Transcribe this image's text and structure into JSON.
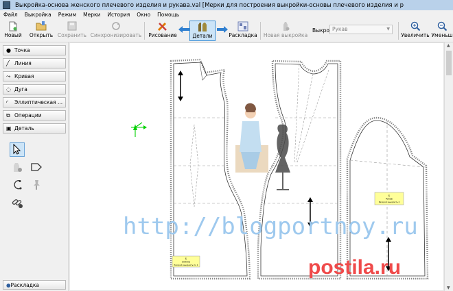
{
  "window": {
    "title": "Выкройка-основа женского плечевого изделия и рукава.val [Мерки для построения выкройки-основы плечевого изделия и р"
  },
  "menu": [
    "Файл",
    "Выкройка",
    "Режим",
    "Мерки",
    "История",
    "Окно",
    "Помощь"
  ],
  "toolbar": {
    "new": "Новый",
    "open": "Открыть",
    "save": "Сохранить",
    "sync": "Синхронизировать",
    "draw": "Рисование",
    "details": "Детали",
    "layout": "Раскладка",
    "new_pattern": "Новая выкройка",
    "pattern_label": "Выкройка:",
    "pattern_value": "Рукав",
    "zoom_in": "Увеличить",
    "zoom_out": "Уменьш"
  },
  "tools": {
    "point": "Точка",
    "line": "Линия",
    "curve": "Кривая",
    "arc": "Дуга",
    "elliptical": "Эллиптическая ...",
    "operations": "Операции",
    "detail": "Деталь",
    "bottom_tab": "Раскладка"
  },
  "canvas": {
    "watermark": "http://blogportnoy.ru",
    "watermark2": "postila.ru",
    "detail_labels": [
      {
        "line1": "Б",
        "line2": "Спинка",
        "line3": "Раскрой: выкроить по 1"
      },
      {
        "line1": "Б",
        "line2": "Рукав",
        "line3": "Раскрой: выкроить 2"
      }
    ]
  },
  "colors": {
    "accent": "#3b8fd6",
    "label_fill": "#ffff99",
    "watermark": "#9ec9ee"
  }
}
